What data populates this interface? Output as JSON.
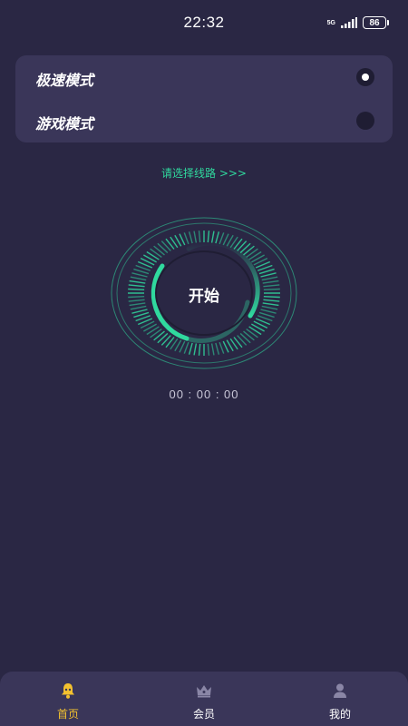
{
  "status_bar": {
    "time": "22:32",
    "network": "5G",
    "battery": "86"
  },
  "modes": {
    "items": [
      {
        "label": "极速模式",
        "selected": true
      },
      {
        "label": "游戏模式",
        "selected": false
      }
    ]
  },
  "route": {
    "prompt": "请选择线路 >>>"
  },
  "dial": {
    "start_label": "开始",
    "timer": "00 : 00 : 00"
  },
  "bottom_nav": {
    "items": [
      {
        "label": "首页",
        "icon": "bell-icon",
        "active": true
      },
      {
        "label": "会员",
        "icon": "crown-icon",
        "active": false
      },
      {
        "label": "我的",
        "icon": "user-icon",
        "active": false
      }
    ]
  },
  "colors": {
    "background": "#2a2744",
    "card": "#3a3659",
    "accent": "#30d99e",
    "nav_active": "#f3c12f"
  }
}
